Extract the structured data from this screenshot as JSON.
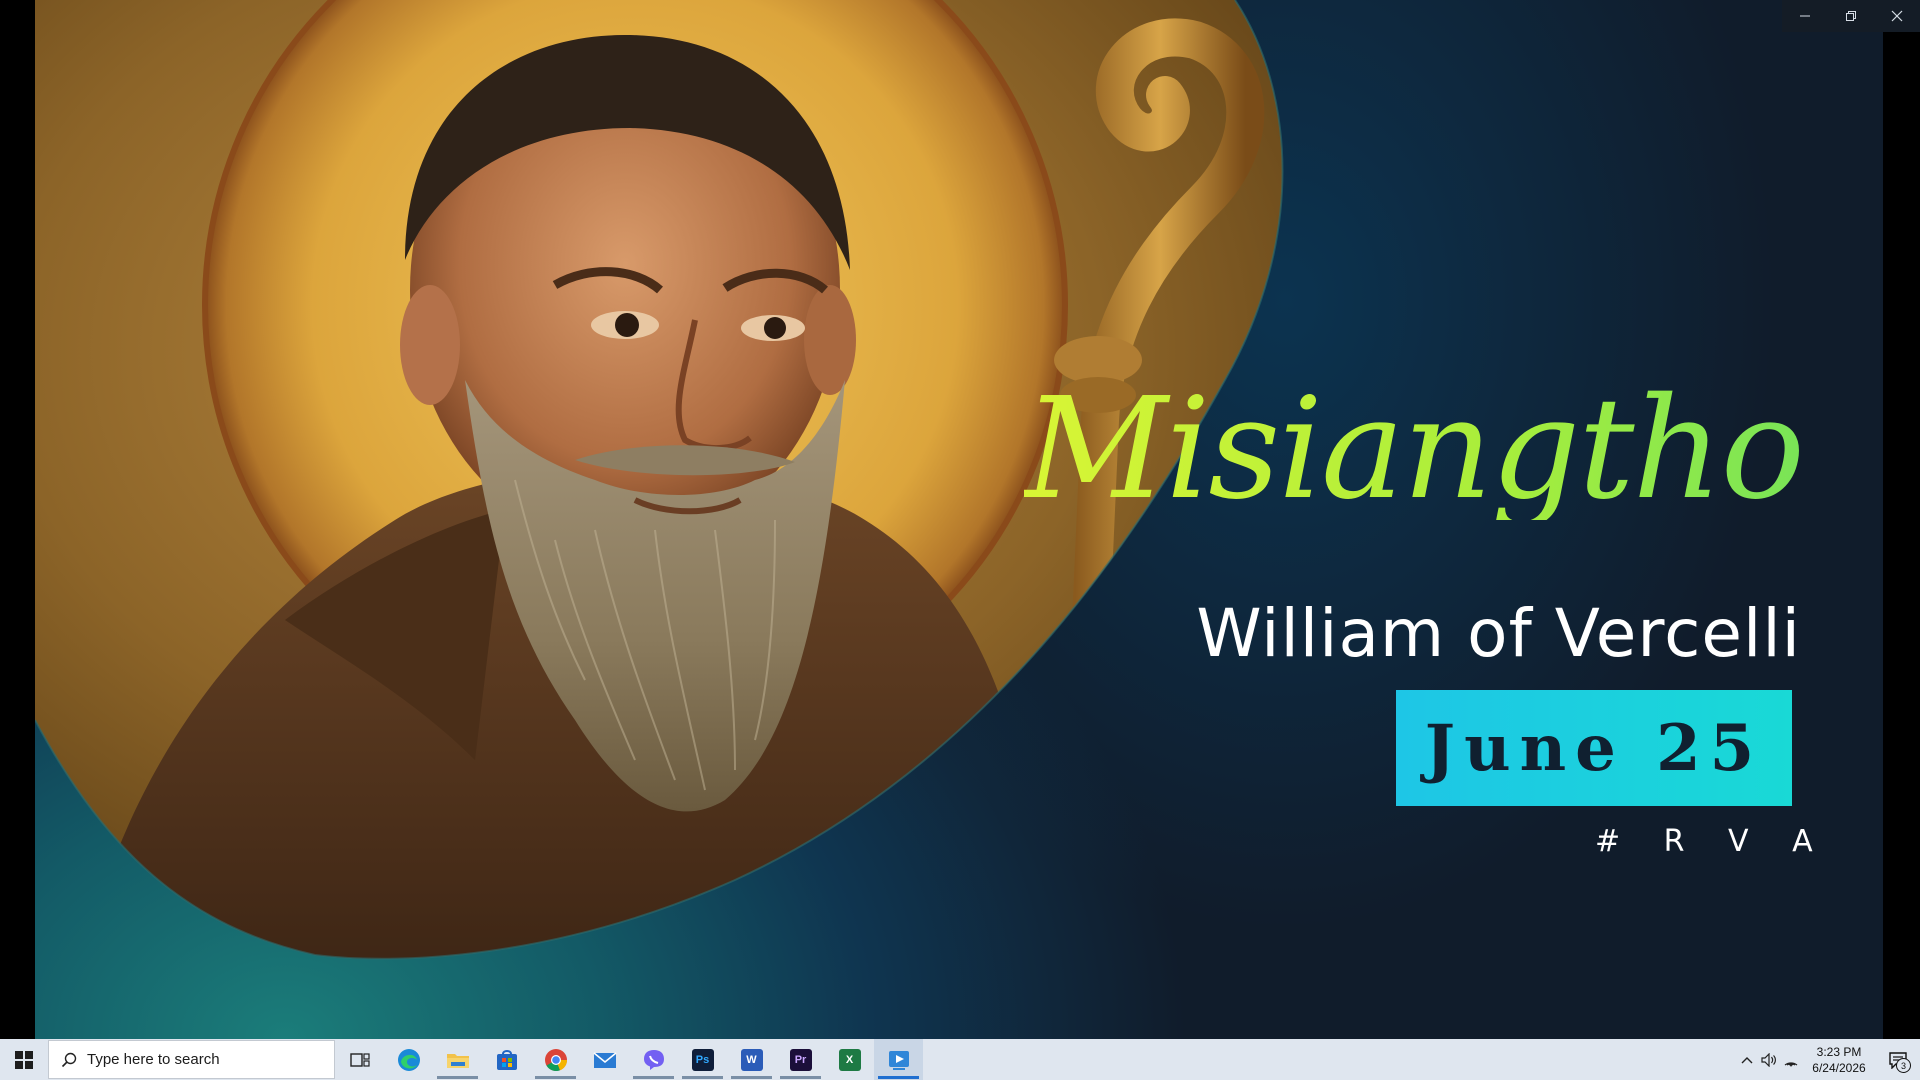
{
  "window": {
    "minimize_icon": "minimize-icon",
    "restore_icon": "restore-icon",
    "close_icon": "close-icon"
  },
  "slide": {
    "painting": "portrait-painting",
    "title": "Misiangtho",
    "subtitle": "William of Vercelli",
    "date": "June 25",
    "hashtag": "# R V A",
    "colors": {
      "title_gradient_start": "#d9f535",
      "title_gradient_end": "#79e457",
      "date_box": "#19d0df",
      "background_dark": "#101c2b",
      "background_teal": "#1b7d7a"
    }
  },
  "taskbar": {
    "search_placeholder": "Type here to search",
    "apps": [
      {
        "name": "task-view",
        "icon": "task-view-icon"
      },
      {
        "name": "edge",
        "icon": "edge-icon"
      },
      {
        "name": "file-explorer",
        "icon": "folder-icon"
      },
      {
        "name": "microsoft-store",
        "icon": "store-icon"
      },
      {
        "name": "chrome",
        "icon": "chrome-icon"
      },
      {
        "name": "mail",
        "icon": "mail-icon"
      },
      {
        "name": "viber",
        "icon": "viber-icon"
      },
      {
        "name": "photoshop",
        "label": "Ps",
        "icon": "photoshop-icon"
      },
      {
        "name": "word",
        "label": "W",
        "icon": "word-icon"
      },
      {
        "name": "premiere",
        "label": "Pr",
        "icon": "premiere-icon"
      },
      {
        "name": "excel",
        "label": "X",
        "icon": "excel-icon"
      },
      {
        "name": "media-player",
        "icon": "media-player-icon"
      }
    ],
    "tray": {
      "time": "3:23 PM",
      "date": "6/24/2026",
      "notification_count": "3"
    }
  }
}
